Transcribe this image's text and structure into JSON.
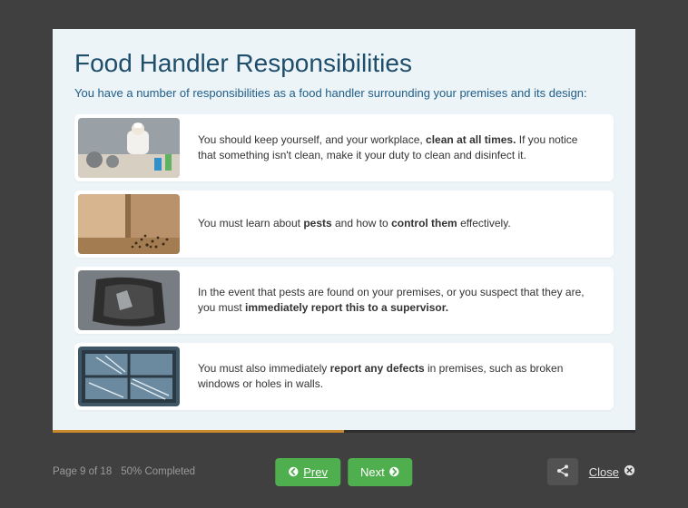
{
  "header": {
    "title": "Food Handler Responsibilities",
    "subtitle": "You have a number of responsibilities as a food handler surrounding your premises and its design:"
  },
  "cards": [
    {
      "pre": "You should keep yourself, and your workplace, ",
      "bold1": "clean at all times.",
      "mid": " If you notice that something isn't clean, make it your duty to clean and disinfect it.",
      "bold2": "",
      "post": ""
    },
    {
      "pre": "You must learn about ",
      "bold1": "pests",
      "mid": " and how to ",
      "bold2": "control them",
      "post": " effectively."
    },
    {
      "pre": "In the event that pests are found on your premises, or you suspect that they are, you must ",
      "bold1": "immediately report this to a supervisor.",
      "mid": "",
      "bold2": "",
      "post": ""
    },
    {
      "pre": "You must also immediately ",
      "bold1": "report any defects",
      "mid": " in premises, such as broken windows or holes in walls.",
      "bold2": "",
      "post": ""
    }
  ],
  "footer": {
    "page_status": "Page 9 of 18",
    "completion": "50% Completed",
    "progress_percent": 50,
    "prev_label": "Prev",
    "next_label": "Next",
    "close_label": "Close"
  },
  "colors": {
    "accent_green": "#4fae4e",
    "heading_blue": "#1f4e6b"
  }
}
